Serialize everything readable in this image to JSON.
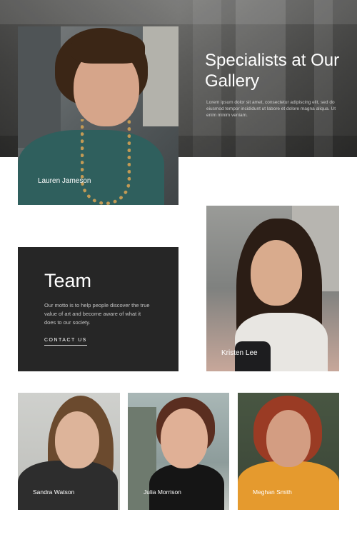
{
  "hero": {
    "title": "Specialists at Our Gallery",
    "body": "Lorem ipsum dolor sit amet, consectetur adipiscing elit, sed do eiusmod tempor incididunt ut labore et dolore magna aliqua. Ut enim minim veniam."
  },
  "team": {
    "title": "Team",
    "motto": "Our motto is to help people discover the true value of art and become aware of what it does to our society.",
    "cta_label": "CONTACT US"
  },
  "members": [
    {
      "name": "Lauren Jameson"
    },
    {
      "name": "Kristen Lee"
    },
    {
      "name": "Sandra Watson"
    },
    {
      "name": "Julia Morrison"
    },
    {
      "name": "Meghan Smith"
    }
  ]
}
